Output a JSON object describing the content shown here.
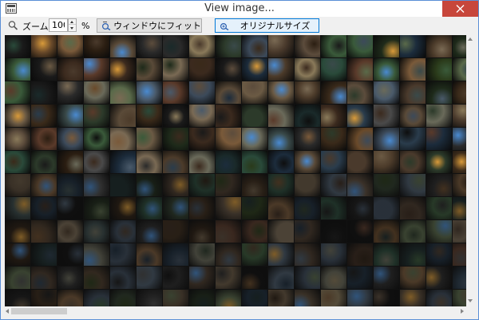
{
  "window": {
    "title": "View image...",
    "accent_color": "#5a8fd6",
    "close_color": "#c7463b",
    "icons": {
      "app": "image-viewer-icon",
      "close": "close-icon"
    }
  },
  "toolbar": {
    "zoom_label": "ズーム:",
    "zoom_value": "100",
    "zoom_unit": "%",
    "fit_button_label": "ウィンドウにフィット",
    "original_button_label": "オリジナルサイズ",
    "icons": {
      "zoom": "magnifier-icon",
      "fit": "fit-window-icon",
      "original": "original-size-icon"
    }
  },
  "image": {
    "description_type": "photo-thumbnail-contact-sheet",
    "thumbnail_colors": [
      "#3b2a1e",
      "#5a4a38",
      "#2c3a2a",
      "#6b5a44",
      "#4a3a2c",
      "#2a2a2a",
      "#7a6a54",
      "#3c4a5a",
      "#1e2a1a",
      "#8a7a5a",
      "#4c3b2a",
      "#2a3c4c",
      "#5c4c3c",
      "#3a5a3a",
      "#1a1a1a",
      "#6a4a2a",
      "#2a4a3a",
      "#4a5a6a",
      "#3a2a1a",
      "#5a6a4a",
      "#2b1e12",
      "#4a4a4a",
      "#1c2c3c",
      "#7a5a3a",
      "#2a3a1a",
      "#0e0e0e",
      "#5a3a2a",
      "#3a4a4a",
      "#6a6a5a",
      "#1a2a2a"
    ]
  }
}
